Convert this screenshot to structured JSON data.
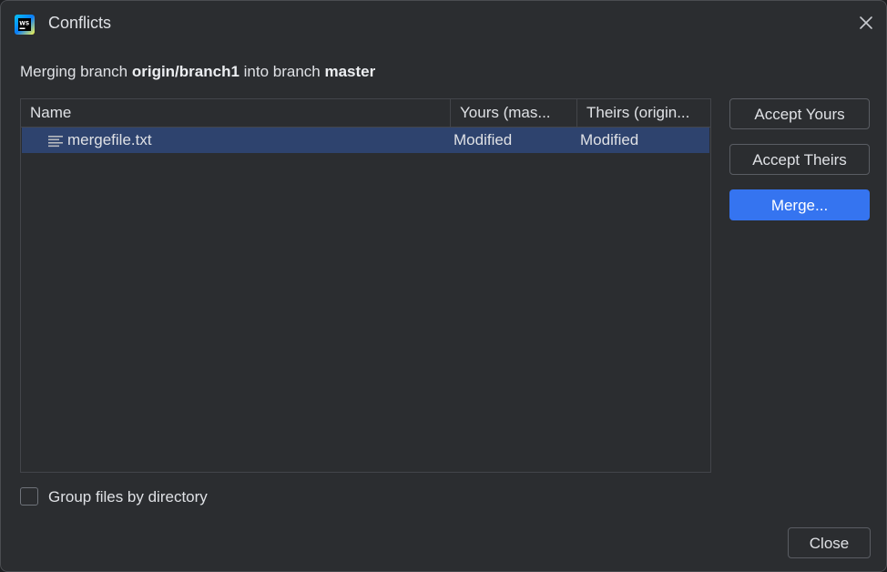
{
  "window": {
    "title": "Conflicts",
    "app_icon": "webstorm-app-icon",
    "close_icon": "close-icon"
  },
  "subtitle": {
    "prefix": "Merging branch ",
    "source_branch": "origin/branch1",
    "middle": " into branch ",
    "target_branch": "master"
  },
  "table": {
    "columns": {
      "name": "Name",
      "yours": "Yours (mas...",
      "theirs": "Theirs (origin..."
    },
    "rows": [
      {
        "file_icon": "text-file-icon",
        "name": "mergefile.txt",
        "yours": "Modified",
        "theirs": "Modified"
      }
    ]
  },
  "buttons": {
    "accept_yours": "Accept Yours",
    "accept_theirs": "Accept Theirs",
    "merge": "Merge...",
    "close": "Close"
  },
  "options": {
    "group_by_directory_label": "Group files by directory",
    "group_by_directory_checked": false
  },
  "colors": {
    "dialog_bg": "#2b2d30",
    "selection_bg": "#2e436e",
    "primary_button": "#3574f0",
    "text": "#dfe1e5"
  }
}
